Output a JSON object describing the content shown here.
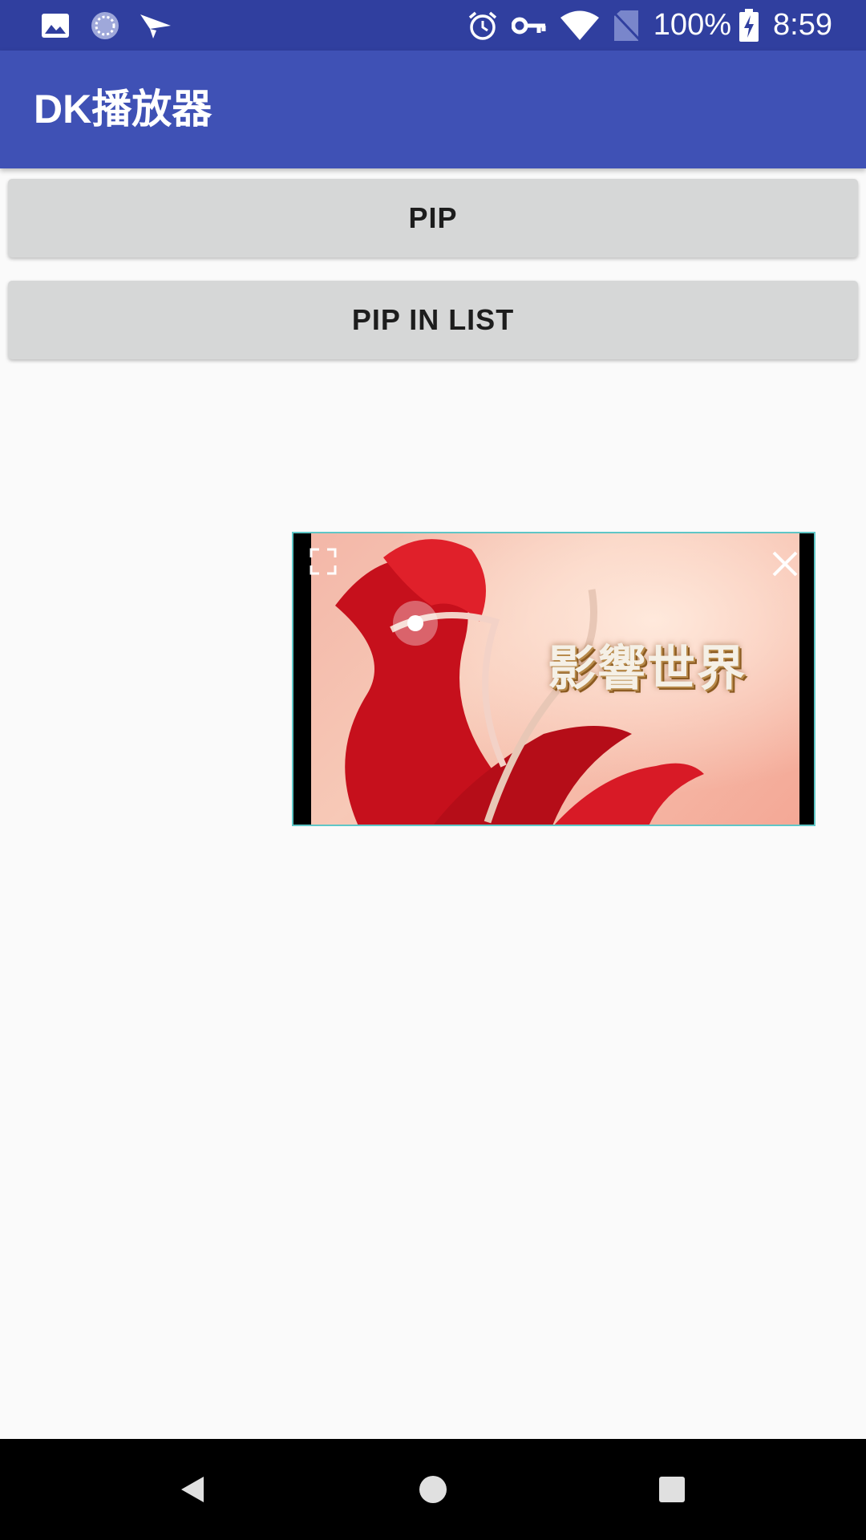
{
  "status_bar": {
    "time": "8:59",
    "battery_percent": "100%",
    "icons": [
      "image-icon",
      "sync-icon",
      "send-icon",
      "alarm-icon",
      "vpn-key-icon",
      "wifi-icon",
      "no-sim-icon",
      "battery-charging-icon"
    ]
  },
  "app_bar": {
    "title": "DK播放器"
  },
  "buttons": {
    "pip": "PIP",
    "pip_in_list": "PIP IN LIST"
  },
  "pip_window": {
    "caption": "影響世界",
    "controls": [
      "fullscreen-icon",
      "close-icon"
    ]
  },
  "nav_bar": {
    "items": [
      "back-icon",
      "home-icon",
      "recents-icon"
    ]
  },
  "colors": {
    "status_bar": "#303f9f",
    "app_bar": "#3f51b5",
    "button": "#d6d7d7",
    "background": "#fafafa",
    "pip_border": "#5fc6c6"
  }
}
